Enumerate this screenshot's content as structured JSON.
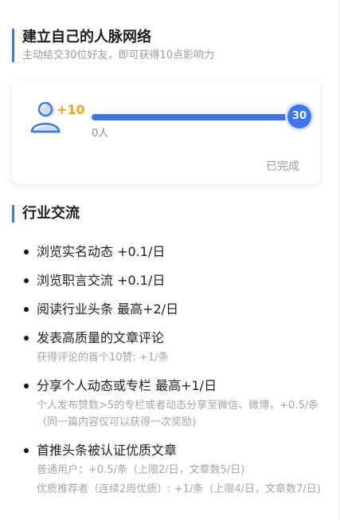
{
  "network": {
    "title": "建立自己的人脉网络",
    "subtitle": "主动结交30位好友，即可获得10点影响力"
  },
  "progress": {
    "reward": "+10",
    "goal": "30",
    "current_label": "0人",
    "status": "已完成",
    "value": 1.0
  },
  "industry": {
    "title": "行业交流",
    "items": [
      {
        "title": "浏览实名动态 +0.1/日",
        "notes": []
      },
      {
        "title": "浏览职言交流 +0.1/日",
        "notes": []
      },
      {
        "title": "阅读行业头条 最高+2/日",
        "notes": []
      },
      {
        "title": "发表高质量的文章评论",
        "notes": [
          "获得评论的首个10赞: +1/条"
        ]
      },
      {
        "title": "分享个人动态或专栏 最高+1/日",
        "notes": [
          "个人发布赞数>5的专栏或者动态分享至微信、微博，+0.5/条（同一篇内容仅可以获得一次奖励)"
        ]
      },
      {
        "title": "首推头条被认证优质文章",
        "notes": [
          "普通用户：+0.5/条（上限2/日，文章数5/日)",
          "优质推荐者（连续2周优质）: +1/条（上限4/日，文章数7/日)"
        ]
      }
    ]
  },
  "colors": {
    "accent": "#3d74f0",
    "reward": "#f2a21b"
  },
  "icons": {
    "avatar": "person-avatar-icon"
  }
}
